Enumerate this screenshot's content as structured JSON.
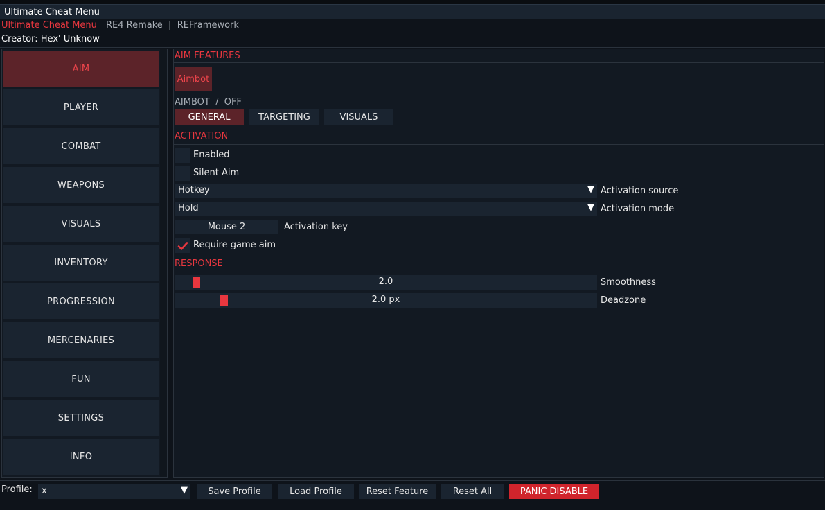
{
  "window": {
    "title": "Ultimate Cheat Menu"
  },
  "header": {
    "brand": "Ultimate Cheat Menu",
    "subtitle": "RE4 Remake  |  REFramework",
    "creator": "Creator: Hex' Unknow"
  },
  "sidebar": {
    "active_index": 0,
    "items": [
      {
        "label": "AIM"
      },
      {
        "label": "PLAYER"
      },
      {
        "label": "COMBAT"
      },
      {
        "label": "WEAPONS"
      },
      {
        "label": "VISUALS"
      },
      {
        "label": "INVENTORY"
      },
      {
        "label": "PROGRESSION"
      },
      {
        "label": "MERCENARIES"
      },
      {
        "label": "FUN"
      },
      {
        "label": "SETTINGS"
      },
      {
        "label": "INFO"
      }
    ]
  },
  "main": {
    "section_aim_features": "AIM FEATURES",
    "feature_button": "Aimbot",
    "status": "AIMBOT  /  OFF",
    "tabs": [
      {
        "label": "GENERAL",
        "active": true
      },
      {
        "label": "TARGETING",
        "active": false
      },
      {
        "label": "VISUALS",
        "active": false
      }
    ],
    "section_activation": "ACTIVATION",
    "enabled": {
      "label": "Enabled",
      "checked": false
    },
    "silent_aim": {
      "label": "Silent Aim",
      "checked": false
    },
    "activation_source": {
      "value": "Hotkey",
      "label": "Activation source"
    },
    "activation_mode": {
      "value": "Hold",
      "label": "Activation mode"
    },
    "activation_key": {
      "value": "Mouse 2",
      "label": "Activation key"
    },
    "require_game_aim": {
      "label": "Require game aim",
      "checked": true
    },
    "section_response": "RESPONSE",
    "smoothness": {
      "display": "2.0",
      "label": "Smoothness",
      "fraction": 0.02
    },
    "deadzone": {
      "display": "2.0 px",
      "label": "Deadzone",
      "fraction": 0.09
    }
  },
  "footer": {
    "profile_label": "Profile:",
    "profile_value": "x",
    "save_profile": "Save Profile",
    "load_profile": "Load Profile",
    "reset_feature": "Reset Feature",
    "reset_all": "Reset All",
    "panic_disable": "PANIC DISABLE"
  },
  "colors": {
    "accent": "#e8373f",
    "active_bg": "#5c2329",
    "panel_bg": "#1a2430",
    "panic": "#d0242c"
  }
}
